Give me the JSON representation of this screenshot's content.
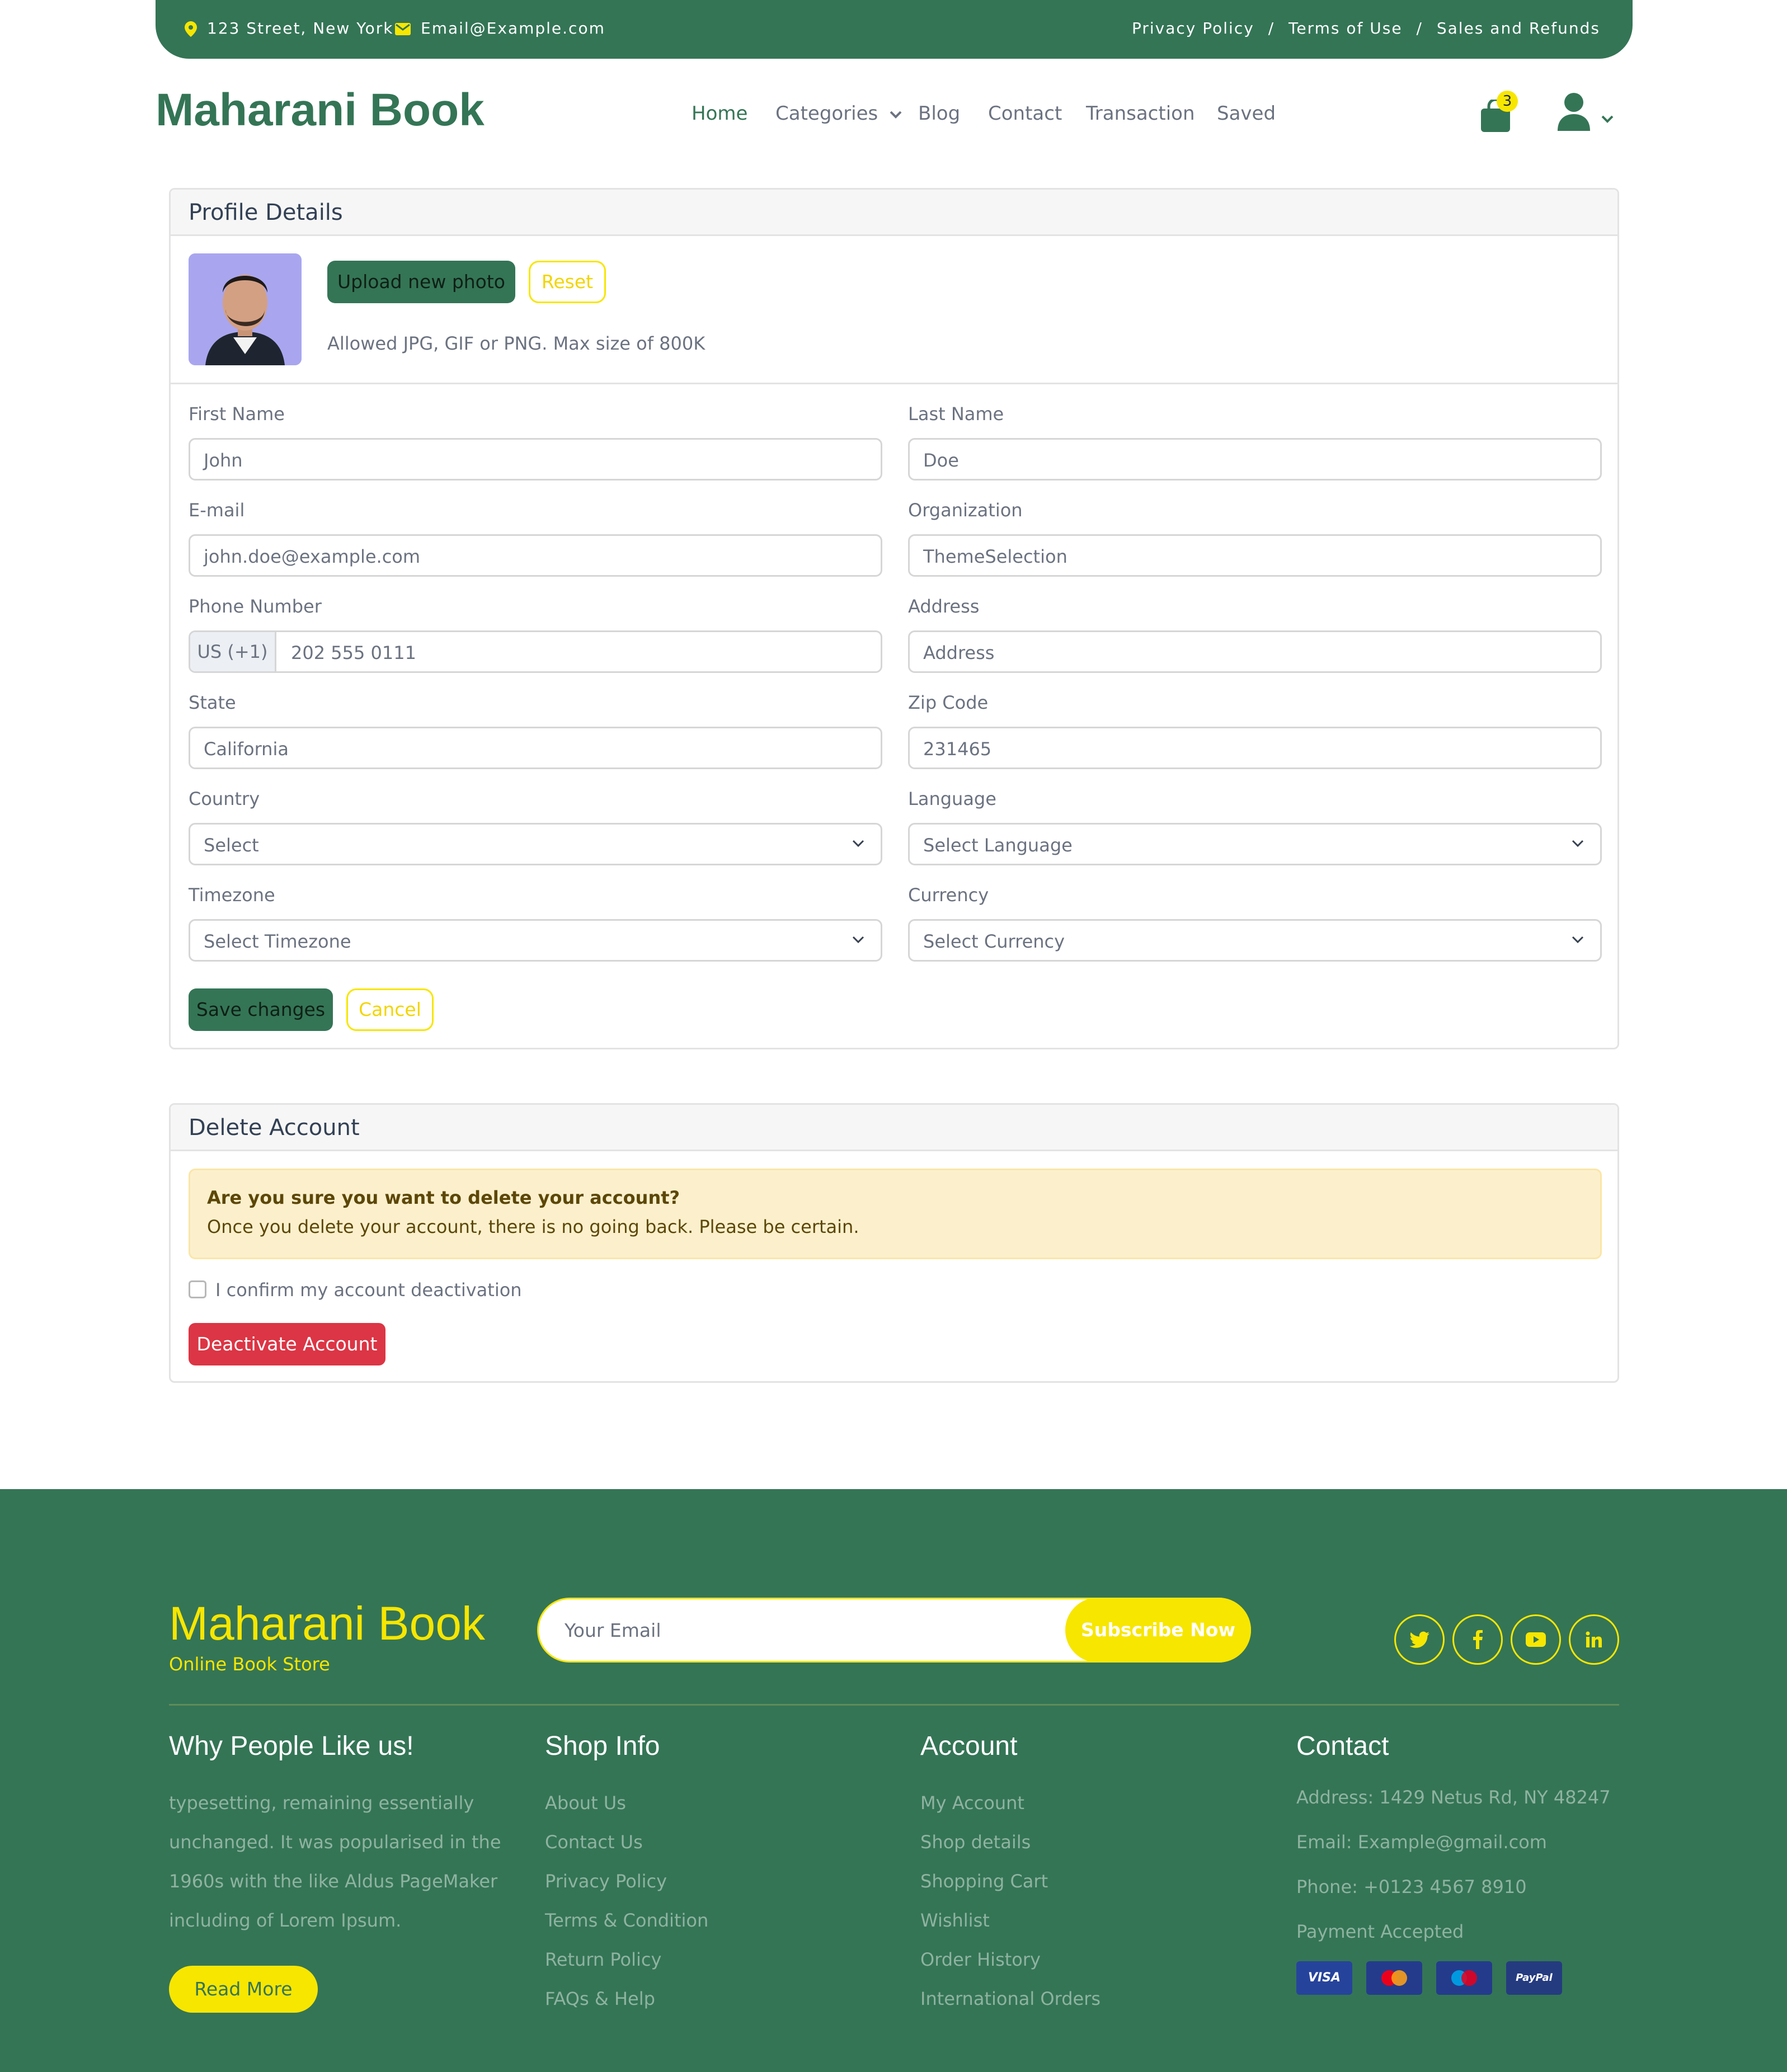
{
  "topbar": {
    "address": "123 Street, New York",
    "email": "Email@Example.com",
    "links": [
      "Privacy Policy",
      "Terms of Use",
      "Sales and Refunds"
    ],
    "separator": "/"
  },
  "header": {
    "brand": "Maharani Book",
    "nav": [
      "Home",
      "Categories",
      "Blog",
      "Contact",
      "Transaction",
      "Saved"
    ],
    "active_nav": "Home",
    "cart_count": "3"
  },
  "profile": {
    "title": "Profile Details",
    "upload_label": "Upload new photo",
    "reset_label": "Reset",
    "photo_hint": "Allowed JPG, GIF or PNG. Max size of 800K",
    "fields": {
      "first_name": {
        "label": "First Name",
        "value": "John"
      },
      "last_name": {
        "label": "Last Name",
        "value": "Doe"
      },
      "email": {
        "label": "E-mail",
        "value": "john.doe@example.com"
      },
      "organization": {
        "label": "Organization",
        "value": "ThemeSelection"
      },
      "phone": {
        "label": "Phone Number",
        "prefix": "US (+1)",
        "value": "202 555 0111"
      },
      "address": {
        "label": "Address",
        "placeholder": "Address"
      },
      "state": {
        "label": "State",
        "value": "California"
      },
      "zip": {
        "label": "Zip Code",
        "value": "231465"
      },
      "country": {
        "label": "Country",
        "value": "Select"
      },
      "language": {
        "label": "Language",
        "value": "Select Language"
      },
      "timezone": {
        "label": "Timezone",
        "value": "Select Timezone"
      },
      "currency": {
        "label": "Currency",
        "value": "Select Currency"
      }
    },
    "save_label": "Save changes",
    "cancel_label": "Cancel"
  },
  "delete": {
    "title": "Delete Account",
    "alert_title": "Are you sure you want to delete your account?",
    "alert_text": "Once you delete your account, there is no going back. Please be certain.",
    "confirm_label": "I confirm my account deactivation",
    "confirm_checked": false,
    "button_label": "Deactivate Account"
  },
  "footer": {
    "brand": "Maharani Book",
    "tagline": "Online Book Store",
    "email_placeholder": "Your Email",
    "subscribe_label": "Subscribe Now",
    "socials": [
      "twitter-icon",
      "facebook-icon",
      "youtube-icon",
      "linkedin-icon"
    ],
    "why": {
      "title": "Why People Like us!",
      "lines": [
        "typesetting, remaining essentially",
        "unchanged. It was popularised in the",
        "1960s with the like Aldus PageMaker",
        "including of Lorem Ipsum."
      ],
      "read_more": "Read More"
    },
    "shop": {
      "title": "Shop Info",
      "links": [
        "About Us",
        "Contact Us",
        "Privacy Policy",
        "Terms & Condition",
        "Return Policy",
        "FAQs & Help"
      ]
    },
    "account": {
      "title": "Account",
      "links": [
        "My Account",
        "Shop details",
        "Shopping Cart",
        "Wishlist",
        "Order History",
        "International Orders"
      ]
    },
    "contact": {
      "title": "Contact",
      "address": "Address: 1429 Netus Rd, NY 48247",
      "email": "Email: Example@gmail.com",
      "phone": "Phone: +0123 4567 8910",
      "payment_label": "Payment Accepted",
      "payments": [
        "VISA",
        "MasterCard",
        "Maestro",
        "PayPal"
      ]
    }
  },
  "colors": {
    "brand_green": "#347556",
    "accent_yellow": "#f7e600",
    "danger_red": "#dc3545",
    "alert_bg": "#fcf0cc"
  }
}
